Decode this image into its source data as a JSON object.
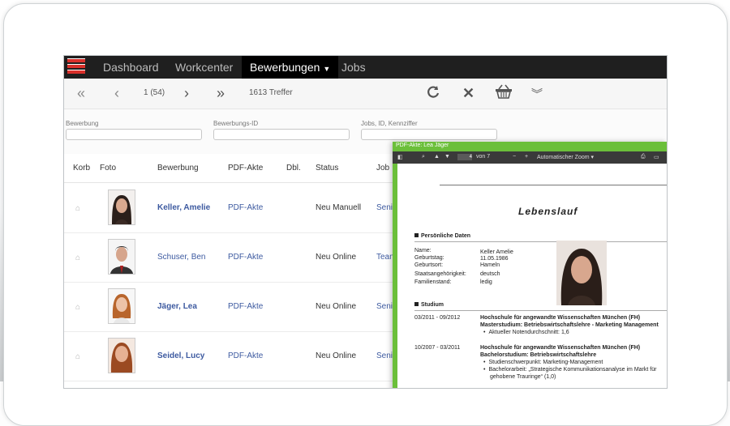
{
  "nav": {
    "items": [
      "Dashboard",
      "Workcenter",
      "Bewerbungen",
      "Jobs"
    ],
    "active": "Bewerbungen"
  },
  "toolbar": {
    "first_icon": "double-chevron-left-icon",
    "prev_icon": "chevron-left-icon",
    "pager": "1 (54)",
    "next_icon": "chevron-right-icon",
    "last_icon": "double-chevron-right-icon",
    "hits": "1613 Treffer",
    "refresh_icon": "refresh-icon",
    "clear_icon": "close-icon",
    "basket_icon": "basket-icon",
    "expand_icon": "double-chevron-down-icon"
  },
  "filters": {
    "bewerbung": {
      "label": "Bewerbung",
      "value": ""
    },
    "bewerbungs_id": {
      "label": "Bewerbungs-ID",
      "value": ""
    },
    "jobs": {
      "label": "Jobs, ID, Kennziffer",
      "value": ""
    }
  },
  "table": {
    "headers": [
      "Korb",
      "Foto",
      "Bewerbung",
      "PDF-Akte",
      "Dbl.",
      "Status",
      "Job"
    ],
    "rows": [
      {
        "name": "Keller, Amelie",
        "bold": true,
        "pdf": "PDF-Akte",
        "status": "Neu Manuell",
        "job": "Seni"
      },
      {
        "name": "Schuser, Ben",
        "bold": false,
        "pdf": "PDF-Akte",
        "status": "Neu Online",
        "job": "Tean"
      },
      {
        "name": "Jäger, Lea",
        "bold": true,
        "pdf": "PDF-Akte",
        "status": "Neu Online",
        "job": "Seni"
      },
      {
        "name": "Seidel, Lucy",
        "bold": true,
        "pdf": "PDF-Akte",
        "status": "Neu Online",
        "job": "Seni"
      }
    ]
  },
  "viewer": {
    "title": "PDF-Akte: Lea Jäger",
    "page_current": "4",
    "page_total": "von 7",
    "zoom": "Automatischer Zoom",
    "doc": {
      "title": "Lebenslauf",
      "personal_heading": "Persönliche Daten",
      "personal": [
        {
          "label": "Name:",
          "value": "Keller Amelie"
        },
        {
          "label": "Geburtstag:",
          "value": "11.05.1986"
        },
        {
          "label": "Geburtsort:",
          "value": "Hameln"
        },
        {
          "label": "Staatsangehörigkeit:",
          "value": "deutsch"
        },
        {
          "label": "Familienstand:",
          "value": "ledig"
        }
      ],
      "study_heading": "Studium",
      "study1_date": "03/2011 - 09/2012",
      "study1_school": "Hochschule für angewandte Wissenschaften München (FH)",
      "study1_program": "Masterstudium: Betriebswirtschaftslehre - Marketing Management",
      "study1_bullets": [
        "Aktueller Notendurchschnitt: 1,6"
      ],
      "study2_date": "10/2007 - 03/2011",
      "study2_school": "Hochschule für angewandte Wissenschaften München (FH)",
      "study2_program": "Bachelorstudium: Betriebswirtschaftslehre",
      "study2_bullets": [
        "Studienschwerpunkt: Marketing-Management",
        "Bachelorarbeit: „Strategische Kommunikationsanalyse im Markt für",
        "gehobene Trauringe“ (1,0)"
      ]
    }
  },
  "colors": {
    "accent": "#6bbf3a",
    "link": "#3d5aa0",
    "nav_bg": "#1f1f1f",
    "logo": "#d9302b"
  }
}
